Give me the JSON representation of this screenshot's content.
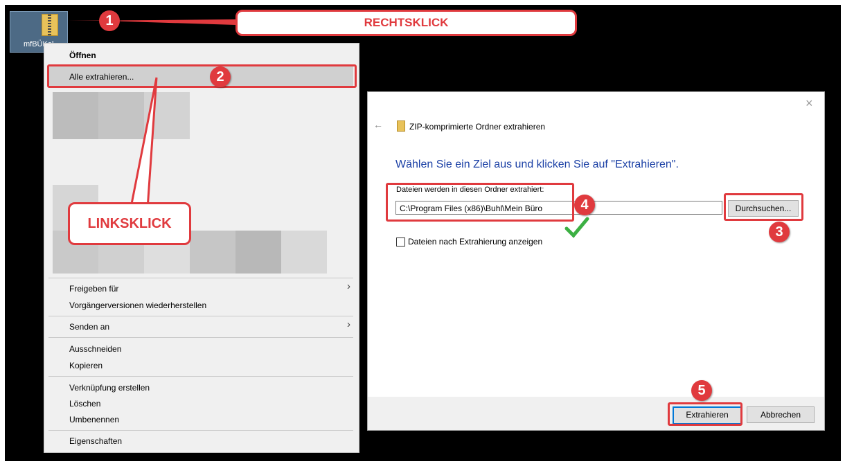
{
  "desktop": {
    "file_label": "mfBÜKal...",
    "file_icon": "zip-folder-icon"
  },
  "context_menu": {
    "open": "Öffnen",
    "extract_all": "Alle extrahieren...",
    "share_with": "Freigeben für",
    "restore_previous": "Vorgängerversionen wiederherstellen",
    "send_to": "Senden an",
    "cut": "Ausschneiden",
    "copy": "Kopieren",
    "create_shortcut": "Verknüpfung erstellen",
    "delete": "Löschen",
    "rename": "Umbenennen",
    "properties": "Eigenschaften",
    "submenu_arrow": "›"
  },
  "dialog": {
    "title": "ZIP-komprimierte Ordner extrahieren",
    "heading": "Wählen Sie ein Ziel aus und klicken Sie auf \"Extrahieren\".",
    "folder_label": "Dateien werden in diesen Ordner extrahiert:",
    "folder_value": "C:\\Program Files (x86)\\Buhl\\Mein Büro",
    "browse_button": "Durchsuchen...",
    "show_files_checkbox": "Dateien nach Extrahierung anzeigen",
    "show_files_checked": false,
    "extract_button": "Extrahieren",
    "cancel_button": "Abbrechen",
    "back_arrow": "←",
    "close_glyph": "×"
  },
  "annotations": {
    "step1": "1",
    "step2": "2",
    "step3": "3",
    "step4": "4",
    "step5": "5",
    "rechtsklick": "RECHTSKLICK",
    "linksklick": "LINKSKLICK",
    "accent_color": "#e03a3e",
    "checkmark_color": "#3cb043"
  }
}
